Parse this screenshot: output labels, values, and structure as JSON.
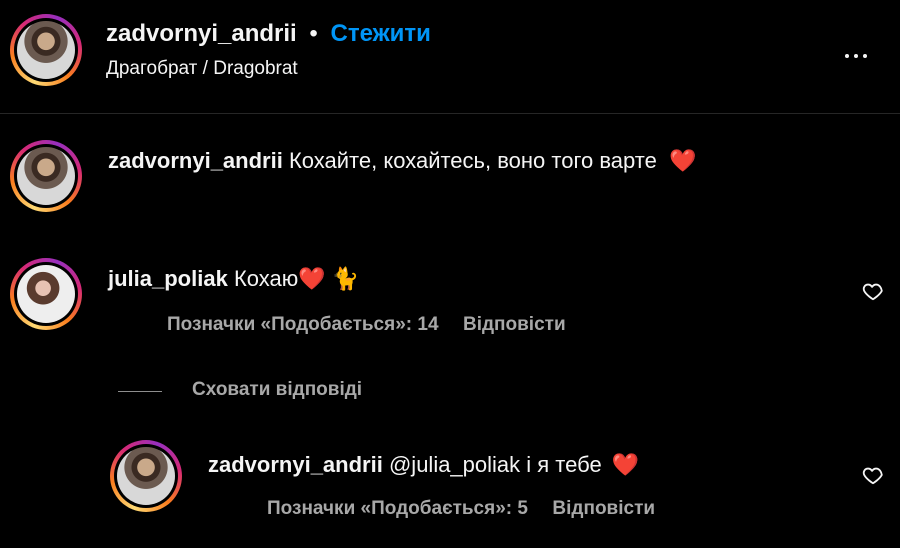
{
  "header": {
    "username": "zadvornyi_andrii",
    "dot": "•",
    "follow_label": "Стежити",
    "location": "Драгобрат / Dragobrat",
    "more_icon": "more-horizontal-icon"
  },
  "caption": {
    "username": "zadvornyi_andrii",
    "text": "Кохайте, кохайтесь, воно того варте",
    "emoji": "❤️"
  },
  "comment": {
    "username": "julia_poliak",
    "text": "Кохаю",
    "emoji": "❤️ 🐈",
    "likes": "Позначки «Подобається»: 14",
    "reply_label": "Відповісти",
    "like_icon": "heart-outline-icon"
  },
  "toggle_replies_label": "Сховати відповіді",
  "reply": {
    "username": "zadvornyi_andrii",
    "text": "@julia_poliak і я тебе",
    "emoji": "❤️",
    "likes": "Позначки «Подобається»: 5",
    "reply_label": "Відповісти",
    "like_icon": "heart-outline-icon"
  },
  "colors": {
    "background": "#000000",
    "follow": "#0095f6",
    "muted": "#a8a8a8",
    "heart": "#ff3040"
  }
}
